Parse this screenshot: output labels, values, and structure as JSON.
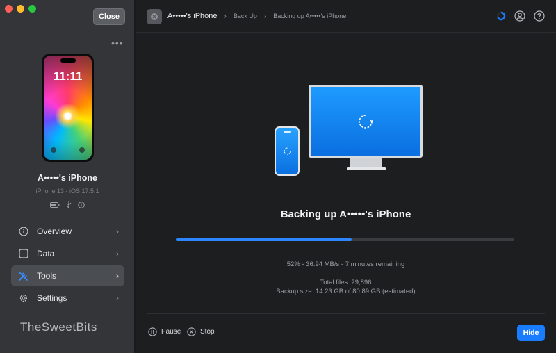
{
  "window": {
    "close_label": "Close",
    "more_icon": "ellipsis-icon"
  },
  "device": {
    "lock_time": "11:11",
    "name": "A•••••'s iPhone",
    "subtitle": "iPhone 13 - iOS 17.5.1"
  },
  "sidebar": {
    "items": [
      {
        "label": "Overview",
        "icon": "info-icon"
      },
      {
        "label": "Data",
        "icon": "square-icon"
      },
      {
        "label": "Tools",
        "icon": "tools-icon"
      },
      {
        "label": "Settings",
        "icon": "gear-icon"
      }
    ],
    "active": "Tools"
  },
  "watermark": "TheSweetBits",
  "breadcrumb": {
    "device": "A•••••'s iPhone",
    "step": "Back Up",
    "current": "Backing up A•••••'s iPhone"
  },
  "backup": {
    "title": "Backing up A•••••'s iPhone",
    "progress_fraction": 0.52,
    "progress_text": "52% - 36.94 MB/s - 7 minutes remaining",
    "total_files": "Total files: 29,896",
    "backup_size": "Backup size: 14.23 GB of 80.89 GB (estimated)"
  },
  "footer": {
    "pause_label": "Pause",
    "stop_label": "Stop",
    "hide_label": "Hide"
  },
  "colors": {
    "accent": "#1a7cff",
    "progress": "#2e86ff",
    "sidebar_bg": "#333538",
    "main_bg": "#1d1e20"
  }
}
